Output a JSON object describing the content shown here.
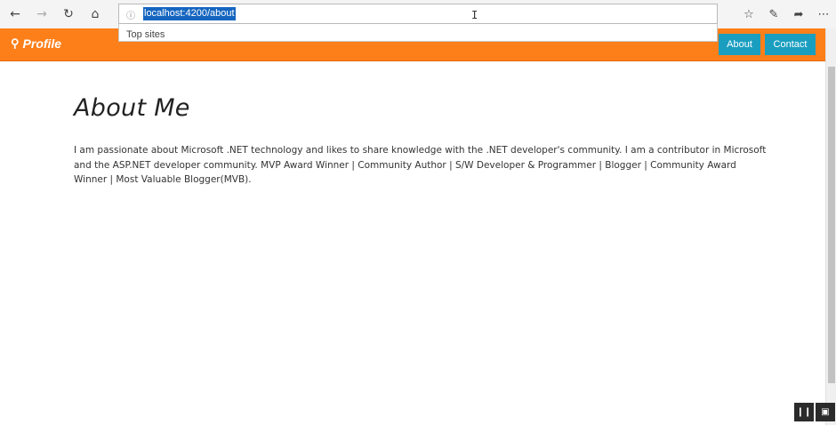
{
  "browser": {
    "url": "localhost:4200/about",
    "address_info_icon": "info-icon",
    "dropdown_item": "Top sites"
  },
  "app": {
    "brand": "Profile",
    "nav": {
      "about": "About",
      "contact": "Contact"
    }
  },
  "page": {
    "title": "About Me",
    "body": "I am passionate about Microsoft .NET technology and likes to share knowledge with the .NET developer's community. I am a contributor in Microsoft and the ASP.NET developer community. MVP Award Winner | Community Author | S/W Developer & Programmer | Blogger | Community Award Winner | Most Valuable Blogger(MVB)."
  },
  "colors": {
    "navbar": "#fd7f1a",
    "nav_button": "#1a9ec0",
    "url_highlight": "#1565c0"
  }
}
